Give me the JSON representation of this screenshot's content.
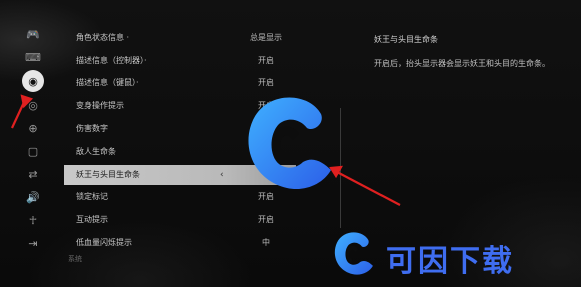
{
  "rail": {
    "items": [
      {
        "name": "gamepad-icon",
        "glyph": "🎮"
      },
      {
        "name": "keyboard-icon",
        "glyph": "⌨"
      },
      {
        "name": "display-icon",
        "glyph": "◉",
        "active": true
      },
      {
        "name": "eye-icon",
        "glyph": "◎"
      },
      {
        "name": "zoom-icon",
        "glyph": "⊕"
      },
      {
        "name": "monitor-icon",
        "glyph": "▢"
      },
      {
        "name": "swap-icon",
        "glyph": "⇄"
      },
      {
        "name": "volume-icon",
        "glyph": "🔊"
      },
      {
        "name": "accessibility-icon",
        "glyph": "☥"
      },
      {
        "name": "exit-icon",
        "glyph": "⇥"
      }
    ]
  },
  "settings": {
    "rows": [
      {
        "label": "角色状态信息 ·",
        "value": "总是显示"
      },
      {
        "label": "描述信息（控制器）·",
        "value": "开启"
      },
      {
        "label": "描述信息（键鼠）·",
        "value": "开启"
      },
      {
        "label": "变身操作提示",
        "value": "开启"
      },
      {
        "label": "伤害数字",
        "value": ""
      },
      {
        "label": "敌人生命条",
        "value": ""
      },
      {
        "label": "妖王与头目生命条",
        "value": "",
        "selected": true,
        "arrow_left": "‹",
        "arrow_right": "›"
      },
      {
        "label": "锁定标记",
        "value": "开启"
      },
      {
        "label": "互动提示",
        "value": "开启"
      },
      {
        "label": "低血量闪烁提示",
        "value": "中"
      }
    ],
    "footer": "系统"
  },
  "description": {
    "title": "妖王与头目生命条",
    "body": "开启后，抬头显示器会显示妖王和头目的生命条。"
  },
  "watermark": {
    "text": "可因下载",
    "color": "#3f6df0"
  }
}
